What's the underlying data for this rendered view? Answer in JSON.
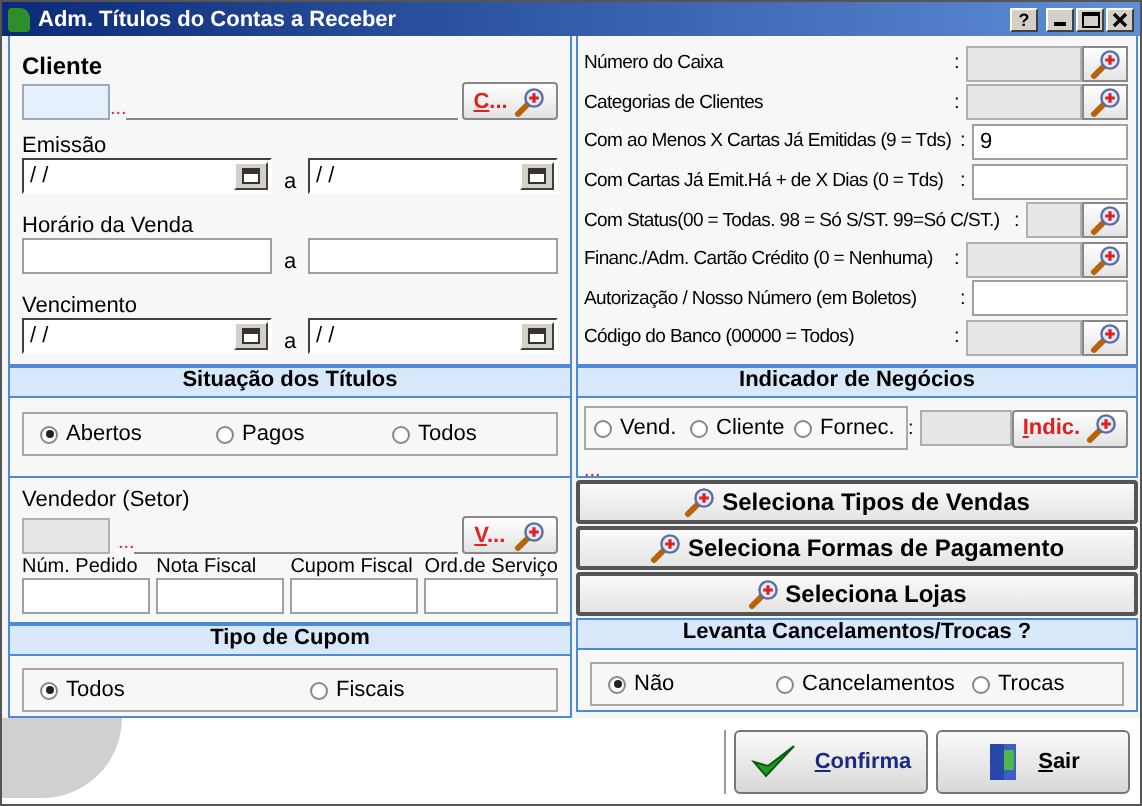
{
  "window": {
    "title": "Adm. Títulos do Contas a Receber",
    "help": "?"
  },
  "cliente": {
    "label": "Cliente",
    "marker": "...",
    "button": "C..."
  },
  "periods": [
    {
      "label": "Emissão",
      "kind": "date",
      "from": "/ /",
      "to": "/ /",
      "separator": "a"
    },
    {
      "label": "Horário da Venda",
      "kind": "time",
      "separator": "a"
    },
    {
      "label": "Vencimento",
      "kind": "date",
      "from": "/ /",
      "to": "/ /",
      "separator": "a"
    }
  ],
  "situacao": {
    "title": "Situação dos Títulos",
    "options": [
      {
        "label": "Abertos",
        "selected": true
      },
      {
        "label": "Pagos",
        "selected": false
      },
      {
        "label": "Todos",
        "selected": false
      }
    ]
  },
  "vendedor": {
    "label": "Vendedor (Setor)",
    "marker": "...",
    "button": "V..."
  },
  "order_fields": [
    {
      "label": "Núm. Pedido"
    },
    {
      "label": "Nota Fiscal"
    },
    {
      "label": "Cupom Fiscal"
    },
    {
      "label": "Ord.de Serviço"
    }
  ],
  "tipo_cupom": {
    "title": "Tipo de Cupom",
    "options": [
      {
        "label": "Todos",
        "selected": true
      },
      {
        "label": "Fiscais",
        "selected": false
      }
    ]
  },
  "filters": [
    {
      "label": "Número do Caixa",
      "colon": ":",
      "kind": "lookup"
    },
    {
      "label": "Categorias de Clientes",
      "colon": ":",
      "kind": "lookup"
    },
    {
      "label": "Com ao Menos X Cartas Já Emitidas (9 = Tds)",
      "colon": ":",
      "kind": "text",
      "value": "9"
    },
    {
      "label": "Com Cartas Já Emit.Há + de X Dias (0 = Tds)",
      "colon": ":",
      "kind": "text"
    },
    {
      "label": "Com Status(00 = Todas. 98 = Só S/ST. 99=Só C/ST.)",
      "colon": ":",
      "kind": "short-lookup"
    },
    {
      "label": "Financ./Adm. Cartão Crédito (0 = Nenhuma)",
      "colon": ":",
      "kind": "lookup"
    },
    {
      "label": "Autorização / Nosso Número (em Boletos)",
      "colon": ":",
      "kind": "text"
    },
    {
      "label": "Código do Banco (00000 = Todos)",
      "colon": ":",
      "kind": "lookup"
    }
  ],
  "indicador": {
    "title": "Indicador de Negócios",
    "options": [
      {
        "label": "Vend.",
        "selected": false
      },
      {
        "label": "Cliente",
        "selected": false
      },
      {
        "label": "Fornec.",
        "selected": false
      }
    ],
    "colon": ":",
    "button": "Indic.",
    "marker": "..."
  },
  "select_buttons": [
    "Seleciona Tipos de Vendas",
    "Seleciona Formas de Pagamento",
    "Seleciona Lojas"
  ],
  "levanta": {
    "title": "Levanta Cancelamentos/Trocas ?",
    "options": [
      {
        "label": "Não",
        "selected": true
      },
      {
        "label": "Cancelamentos",
        "selected": false
      },
      {
        "label": "Trocas",
        "selected": false
      }
    ]
  },
  "footer_buttons": [
    {
      "label": "Confirma",
      "kind": "confirm"
    },
    {
      "label": "Sair",
      "kind": "exit"
    }
  ]
}
